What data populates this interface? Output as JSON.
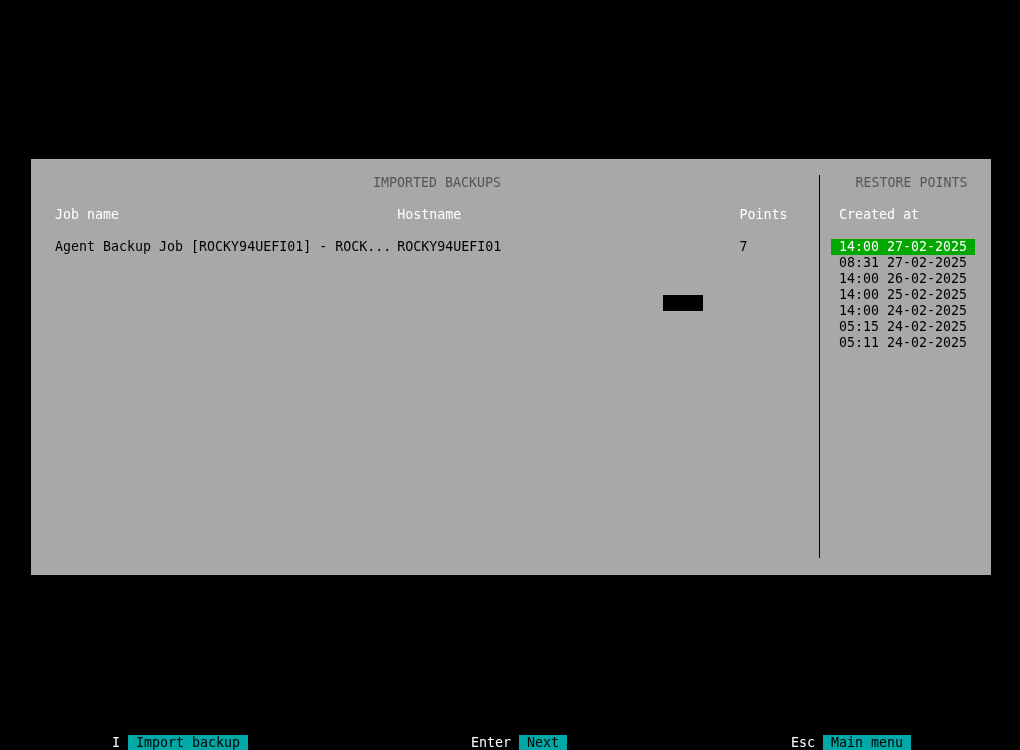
{
  "imported_backups": {
    "title": "IMPORTED BACKUPS",
    "columns": [
      "Job name",
      "Hostname",
      "Points"
    ],
    "rows": [
      {
        "job_name": "Agent Backup Job [ROCKY94UEFI01] - ROCK...",
        "hostname": "ROCKY94UEFI01",
        "points": "7"
      }
    ]
  },
  "restore_points": {
    "title": "RESTORE POINTS",
    "column": "Created at",
    "items": [
      {
        "label": "14:00 27-02-2025",
        "selected": true
      },
      {
        "label": "08:31 27-02-2025",
        "selected": false
      },
      {
        "label": "14:00 26-02-2025",
        "selected": false
      },
      {
        "label": "14:00 25-02-2025",
        "selected": false
      },
      {
        "label": "14:00 24-02-2025",
        "selected": false
      },
      {
        "label": "05:15 24-02-2025",
        "selected": false
      },
      {
        "label": "05:11 24-02-2025",
        "selected": false
      }
    ]
  },
  "hotkeys": [
    {
      "key": "I",
      "label": "Import backup"
    },
    {
      "key": "Enter",
      "label": "Next"
    },
    {
      "key": "Esc",
      "label": "Main menu"
    }
  ]
}
